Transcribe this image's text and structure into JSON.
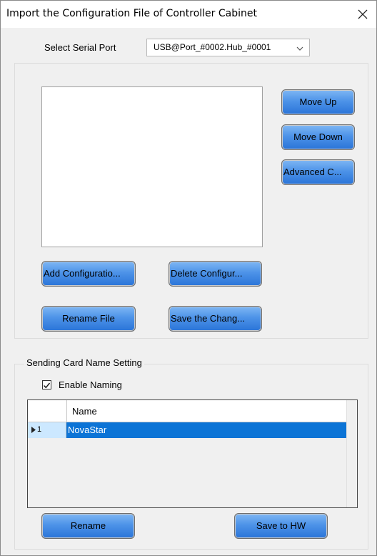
{
  "window": {
    "title": "Import the Configuration File of Controller Cabinet"
  },
  "serial_port": {
    "label": "Select Serial Port",
    "value": "USB@Port_#0002.Hub_#0001"
  },
  "config_files": {
    "items": [],
    "buttons": {
      "move_up": "Move Up",
      "move_down": "Move Down",
      "advanced": "Advanced C...",
      "add": "Add Configuratio...",
      "delete": "Delete Configur...",
      "rename_file": "Rename File",
      "save_changes": "Save the Chang..."
    }
  },
  "naming": {
    "legend": "Sending Card Name Setting",
    "enable_label": "Enable Naming",
    "enabled": true,
    "table": {
      "header": "Name",
      "rows": [
        {
          "index": "1",
          "name": "NovaStar",
          "selected": true
        }
      ]
    },
    "buttons": {
      "rename": "Rename",
      "save_hw": "Save to HW"
    }
  },
  "colors": {
    "selection": "#0c74d6",
    "row_header_selected": "#cce8ff",
    "button_top": "#7fb7f4",
    "button_bottom": "#2a74d8"
  }
}
